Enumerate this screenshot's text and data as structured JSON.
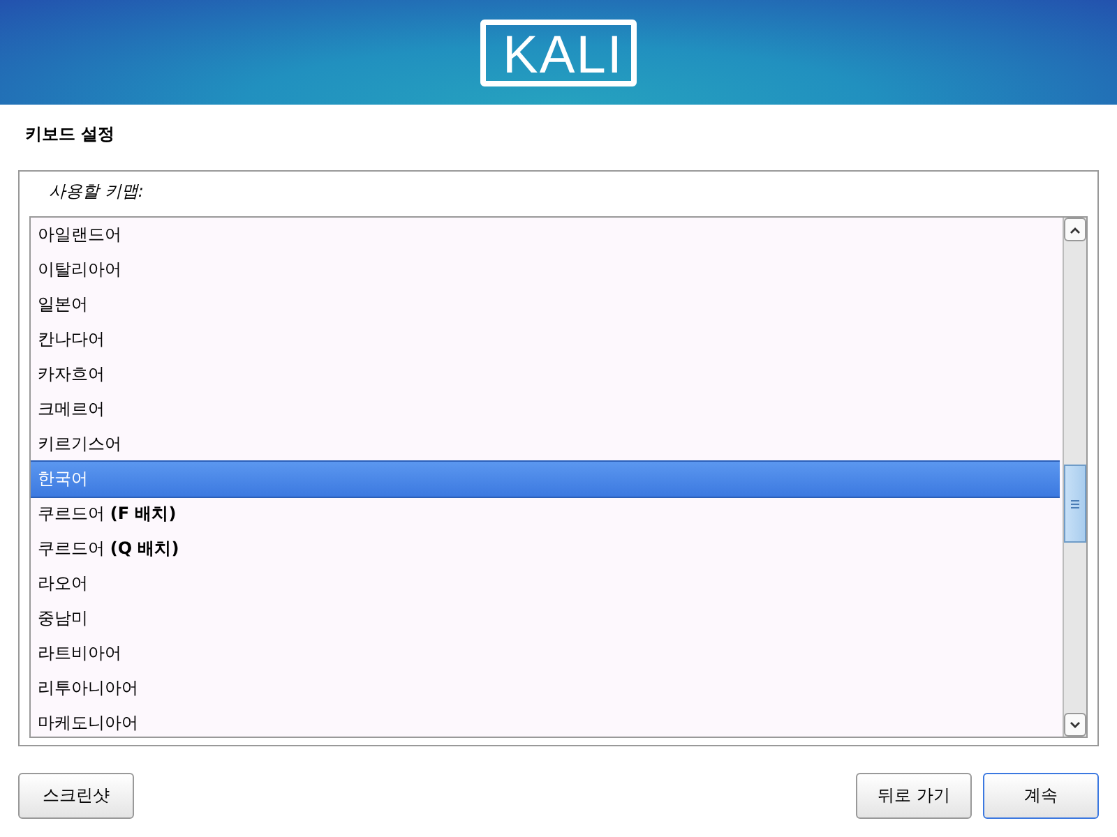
{
  "header": {
    "logo": "KALI"
  },
  "title": "키보드 설정",
  "keymap": {
    "label": "사용할 키맵:",
    "items": [
      {
        "label": "아일랜드어",
        "selected": false
      },
      {
        "label": "이탈리아어",
        "selected": false
      },
      {
        "label": "일본어",
        "selected": false
      },
      {
        "label": "칸나다어",
        "selected": false
      },
      {
        "label": "카자흐어",
        "selected": false
      },
      {
        "label": "크메르어",
        "selected": false
      },
      {
        "label": "키르기스어",
        "selected": false
      },
      {
        "label": "한국어",
        "selected": true
      },
      {
        "label": "쿠르드어 **(F 배치)**",
        "selected": false
      },
      {
        "label": "쿠르드어 **(Q 배치)**",
        "selected": false
      },
      {
        "label": "라오어",
        "selected": false
      },
      {
        "label": "중남미",
        "selected": false
      },
      {
        "label": "라트비아어",
        "selected": false
      },
      {
        "label": "리투아니아어",
        "selected": false
      },
      {
        "label": "마케도니아어",
        "selected": false
      }
    ]
  },
  "buttons": [
    {
      "label": "스크린샷",
      "kind": "left",
      "focused": false
    },
    {
      "label": "뒤로 가기",
      "kind": "right",
      "focused": false
    },
    {
      "label": "계속",
      "kind": "right",
      "focused": true
    }
  ]
}
